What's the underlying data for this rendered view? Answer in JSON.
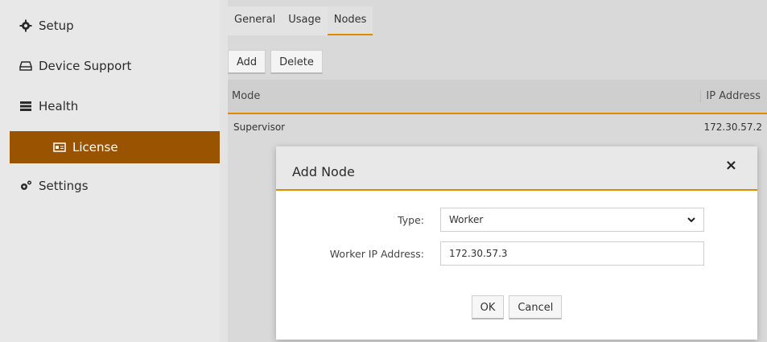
{
  "sidebar": {
    "items": [
      {
        "label": "Setup",
        "icon": "gear-icon"
      },
      {
        "label": "Device Support",
        "icon": "drive-icon"
      },
      {
        "label": "Health",
        "icon": "server-stack-icon"
      },
      {
        "label": "License",
        "icon": "id-card-icon"
      },
      {
        "label": "Settings",
        "icon": "gears-icon"
      }
    ]
  },
  "tabs": [
    "General",
    "Usage",
    "Nodes"
  ],
  "toolbar": {
    "add_label": "Add",
    "delete_label": "Delete"
  },
  "grid": {
    "columns": [
      "Mode",
      "IP Address"
    ],
    "rows": [
      {
        "mode": "Supervisor",
        "ip": "172.30.57.2"
      }
    ]
  },
  "modal": {
    "title": "Add Node",
    "close_label": "×",
    "type_label": "Type:",
    "type_value": "Worker",
    "ip_label": "Worker IP Address:",
    "ip_value": "172.30.57.3",
    "ok_label": "OK",
    "cancel_label": "Cancel"
  },
  "colors": {
    "accent": "#e08a00",
    "active_sidebar": "#9a5300"
  }
}
